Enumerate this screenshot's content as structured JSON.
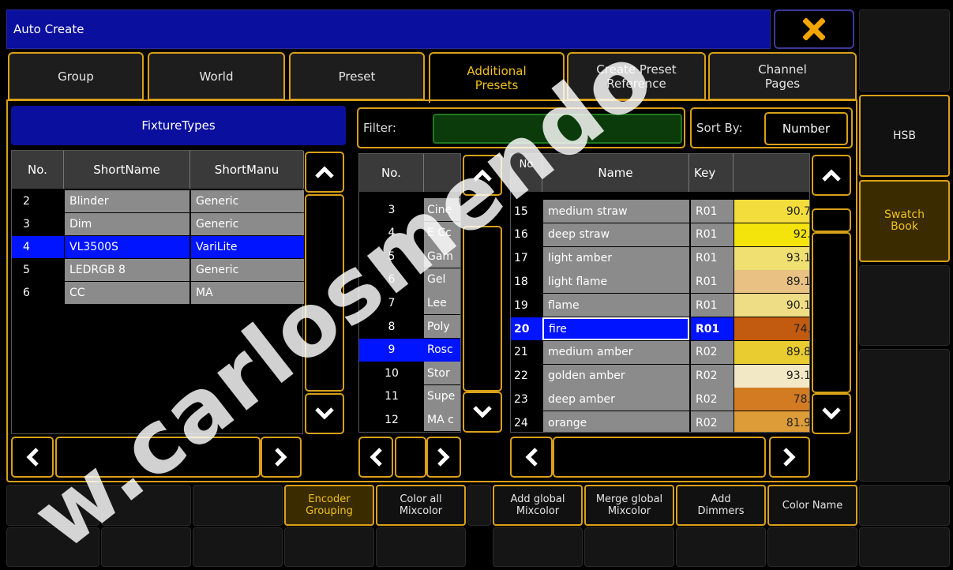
{
  "window": {
    "title": "Auto Create",
    "close_icon": "close-icon"
  },
  "tabs": [
    {
      "label": "Group",
      "active": false
    },
    {
      "label": "World",
      "active": false
    },
    {
      "label": "Preset",
      "active": false
    },
    {
      "label": "Additional Presets",
      "active": true
    },
    {
      "label": "Create Preset Reference",
      "active": false
    },
    {
      "label": "Channel Pages",
      "active": false
    }
  ],
  "fixture_types": {
    "title": "FixtureTypes",
    "columns": [
      "No.",
      "ShortName",
      "ShortManu"
    ],
    "rows": [
      {
        "no": "2",
        "name": "Blinder",
        "manu": "Generic",
        "selected": false
      },
      {
        "no": "3",
        "name": "Dim",
        "manu": "Generic",
        "selected": false
      },
      {
        "no": "4",
        "name": "VL3500S",
        "manu": "VariLite",
        "selected": true
      },
      {
        "no": "5",
        "name": "LEDRGB 8",
        "manu": "Generic",
        "selected": false
      },
      {
        "no": "6",
        "name": "CC",
        "manu": "MA",
        "selected": false
      }
    ]
  },
  "filter": {
    "label": "Filter:",
    "value": ""
  },
  "sort": {
    "label": "Sort By:",
    "value": "Number"
  },
  "gel_books": {
    "columns": [
      "No.",
      ""
    ],
    "rows": [
      {
        "no": "3",
        "name": "Cine",
        "selected": false
      },
      {
        "no": "4",
        "name": "E Cc",
        "selected": false
      },
      {
        "no": "5",
        "name": "Gam",
        "selected": false
      },
      {
        "no": "6",
        "name": "Gel",
        "selected": false
      },
      {
        "no": "7",
        "name": "Lee",
        "selected": false
      },
      {
        "no": "8",
        "name": "Poly",
        "selected": false
      },
      {
        "no": "9",
        "name": "Rosc",
        "selected": true
      },
      {
        "no": "10",
        "name": "Stor",
        "selected": false
      },
      {
        "no": "11",
        "name": "Supe",
        "selected": false
      },
      {
        "no": "12",
        "name": "MA c",
        "selected": false
      }
    ]
  },
  "colors": {
    "columns": [
      "No",
      "Name",
      "Key",
      ""
    ],
    "rows": [
      {
        "no": "15",
        "name": "medium straw",
        "key": "R01",
        "value": "90.7",
        "swatch": "#f2dd3c",
        "selected": false
      },
      {
        "no": "16",
        "name": "deep straw",
        "key": "R01",
        "value": "92.",
        "swatch": "#f4e40c",
        "selected": false
      },
      {
        "no": "17",
        "name": "light amber",
        "key": "R01",
        "value": "93.1",
        "swatch": "#f0e072",
        "selected": false
      },
      {
        "no": "18",
        "name": "light flame",
        "key": "R01",
        "value": "89.1",
        "swatch": "#e9c183",
        "selected": false
      },
      {
        "no": "19",
        "name": "flame",
        "key": "R01",
        "value": "90.1",
        "swatch": "#efdd85",
        "selected": false
      },
      {
        "no": "20",
        "name": "fire",
        "key": "R01",
        "value": "74.",
        "swatch": "#c25a10",
        "selected": true
      },
      {
        "no": "21",
        "name": "medium amber",
        "key": "R02",
        "value": "89.8",
        "swatch": "#e8cc30",
        "selected": false
      },
      {
        "no": "22",
        "name": "golden amber",
        "key": "R02",
        "value": "93.1",
        "swatch": "#f2e8c6",
        "selected": false
      },
      {
        "no": "23",
        "name": "deep amber",
        "key": "R02",
        "value": "78.",
        "swatch": "#d37b22",
        "selected": false
      },
      {
        "no": "24",
        "name": "orange",
        "key": "R02",
        "value": "81.9",
        "swatch": "#dd9c38",
        "selected": false
      }
    ]
  },
  "side": {
    "hsb": "HSB",
    "swatch_book": "Swatch Book"
  },
  "bottom": {
    "encoder_grouping": "Encoder Grouping",
    "color_all_mixcolor": "Color all Mixcolor",
    "add_global_mixcolor": "Add global Mixcolor",
    "merge_global_mixcolor": "Merge global Mixcolor",
    "add_dimmers": "Add Dimmers",
    "color_name": "Color Name"
  },
  "watermark": "w.carlosmendo",
  "accent": "#d9a019"
}
